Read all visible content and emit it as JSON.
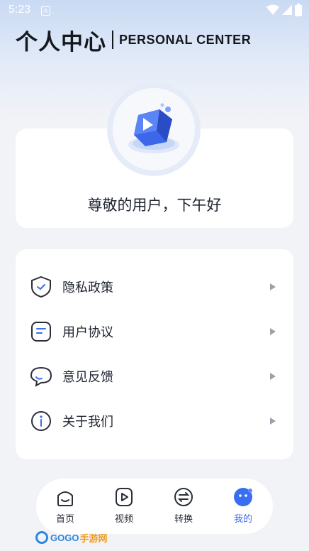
{
  "status_bar": {
    "time": "5:23",
    "notification_letter": "A"
  },
  "header": {
    "title": "个人中心",
    "subtitle": "PERSONAL CENTER"
  },
  "user": {
    "greeting": "尊敬的用户，下午好"
  },
  "menu": {
    "items": [
      {
        "label": "隐私政策",
        "icon": "shield-check-icon"
      },
      {
        "label": "用户协议",
        "icon": "document-icon"
      },
      {
        "label": "意见反馈",
        "icon": "chat-bubble-icon"
      },
      {
        "label": "关于我们",
        "icon": "info-icon"
      }
    ]
  },
  "tabbar": {
    "tabs": [
      {
        "label": "首页",
        "icon": "home-smile-icon"
      },
      {
        "label": "视频",
        "icon": "play-icon"
      },
      {
        "label": "转换",
        "icon": "swap-icon"
      },
      {
        "label": "我的",
        "icon": "profile-face-icon",
        "active": true
      }
    ]
  },
  "watermark": {
    "brand": "GOGO",
    "suffix": "手游网"
  },
  "colors": {
    "accent": "#3a6ef0",
    "text": "#1f2330",
    "background": "#f2f3f7"
  }
}
